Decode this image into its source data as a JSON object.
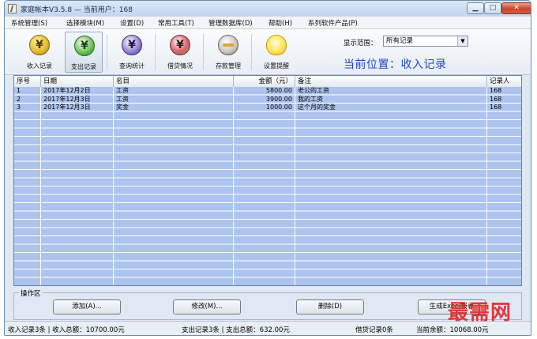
{
  "window": {
    "title": "家庭帐本V3.5.8 — 当前用户：168",
    "controls": {
      "minimize": "▁",
      "maximize": "□",
      "close": "✕"
    }
  },
  "menu": [
    "系统管理(S)",
    "选择模块(M)",
    "设置(D)",
    "常用工具(T)",
    "管理数据库(D)",
    "帮助(H)",
    "系列软件产品(P)"
  ],
  "toolbar": {
    "income": {
      "label": "收入记录",
      "icon": "income-coin-icon",
      "glyph": "¥"
    },
    "expense": {
      "label": "支出记录",
      "icon": "expense-coin-icon",
      "glyph": "¥"
    },
    "stats": {
      "label": "查询统计",
      "icon": "stats-coin-icon",
      "glyph": "¥"
    },
    "loan": {
      "label": "借贷情况",
      "icon": "loan-coin-icon",
      "glyph": "¥"
    },
    "deposit": {
      "label": "存款管理",
      "icon": "deposit-icon"
    },
    "reminder": {
      "label": "设置提醒",
      "icon": "lightbulb-icon"
    }
  },
  "range": {
    "label": "显示范围：",
    "value": "所有记录",
    "arrow": "▼"
  },
  "position_text": "当前位置：收入记录",
  "table": {
    "columns": [
      "序号",
      "日期",
      "名目",
      "金额（元）",
      "备注",
      "记录人"
    ],
    "rows": [
      [
        "1",
        "2017年12月2日",
        "工资",
        "5800.00",
        "老公的工资",
        "168"
      ],
      [
        "2",
        "2017年12月3日",
        "工资",
        "3900.00",
        "我的工资",
        "168"
      ],
      [
        "3",
        "2017年12月3日",
        "奖金",
        "1000.00",
        "这个月的奖金",
        "168"
      ]
    ]
  },
  "operations": {
    "title": "操作区",
    "add": "添加(A)...",
    "edit": "修改(M)...",
    "delete": "删除(D)",
    "excel": "生成Excel报表"
  },
  "status": {
    "income": "收入记录3条 | 收入总额：10700.00元",
    "expense": "支出记录3条 | 支出总额：632.00元",
    "loan": "借贷记录0条",
    "balance": "当前余额：10068.00元"
  },
  "watermark": "最需网",
  "colors": {
    "accent": "#2345c8",
    "row_bg": "#acc4ee",
    "watermark": "#e02a2a"
  }
}
